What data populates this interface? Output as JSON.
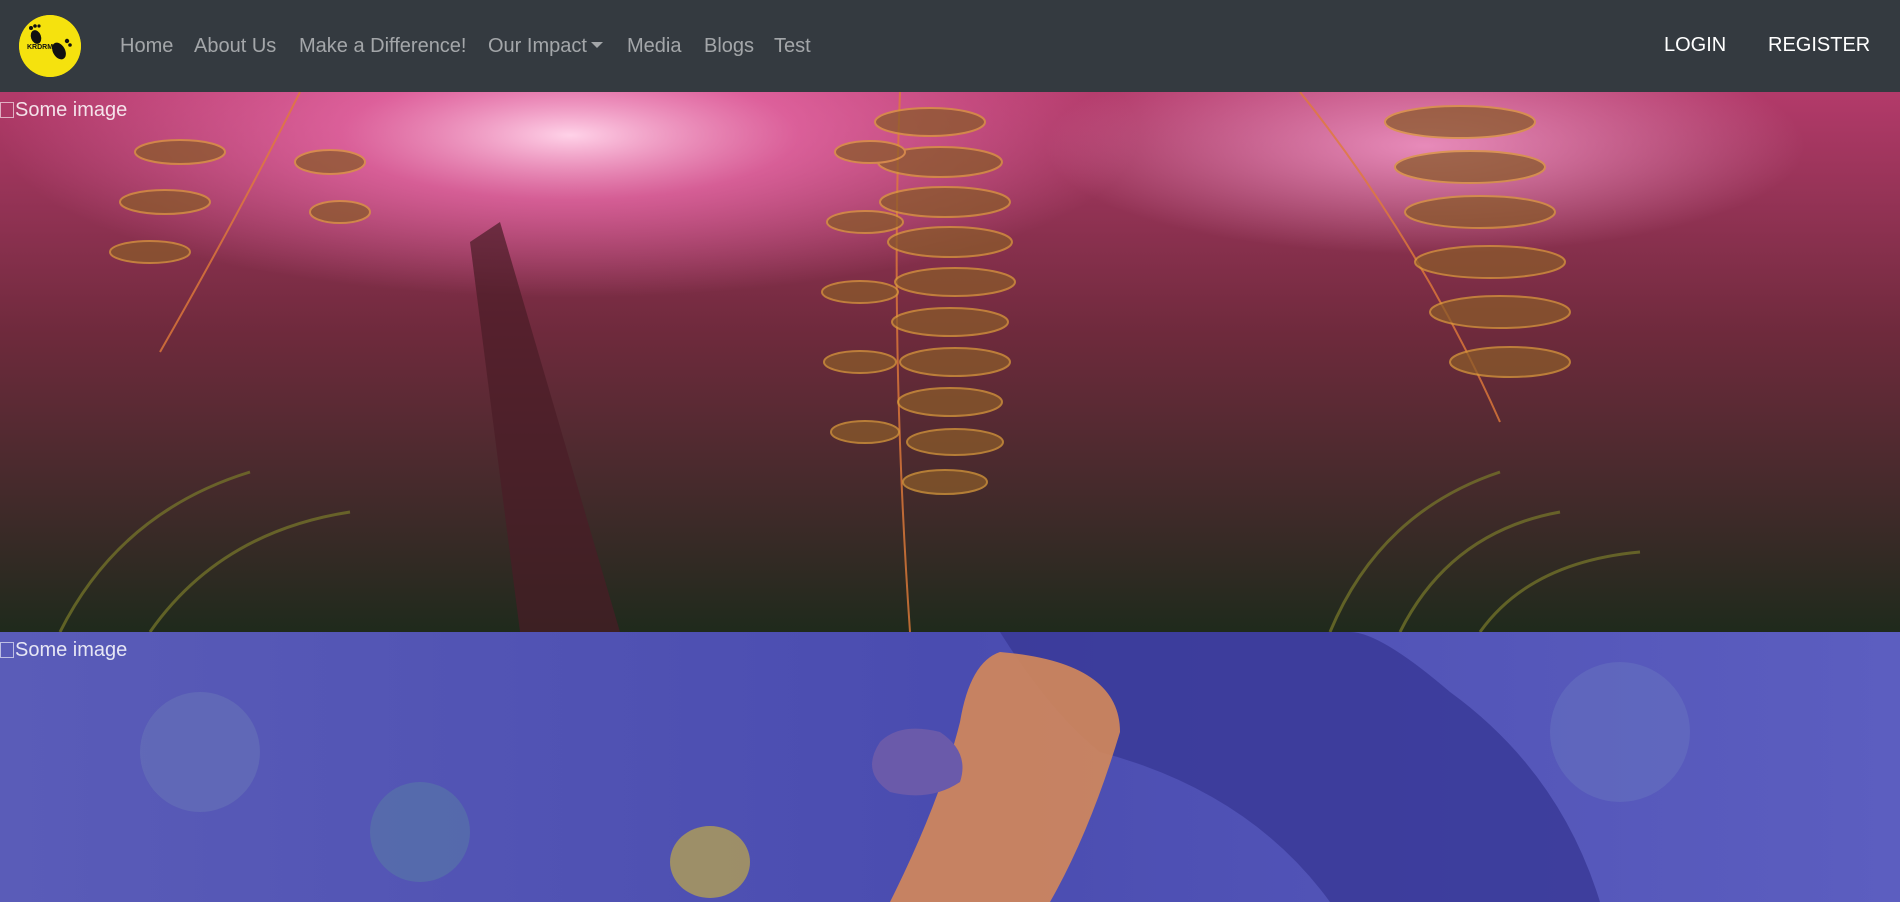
{
  "brand": {
    "logo_icon": "footprint-logo-icon",
    "logo_text": "KRDRM",
    "logo_color": "#f5e20e"
  },
  "nav": {
    "links": [
      {
        "label": "Home"
      },
      {
        "label": "About Us"
      },
      {
        "label": "Make a Difference!"
      },
      {
        "label": "Our Impact",
        "dropdown": true
      },
      {
        "label": "Media"
      },
      {
        "label": "Blogs"
      },
      {
        "label": "Test"
      }
    ],
    "login_label": "LOGIN",
    "register_label": "REGISTER"
  },
  "hero_images": [
    {
      "alt": "Some image",
      "scene": "ferns-at-sunset",
      "tint": "#b0305e"
    },
    {
      "alt": "Some image",
      "scene": "monkey-eating-fruit",
      "tint": "#4848c8"
    }
  ],
  "colors": {
    "navbar_bg": "#343a40",
    "nav_link": "rgba(255,255,255,0.55)",
    "auth_link": "#ffffff"
  }
}
